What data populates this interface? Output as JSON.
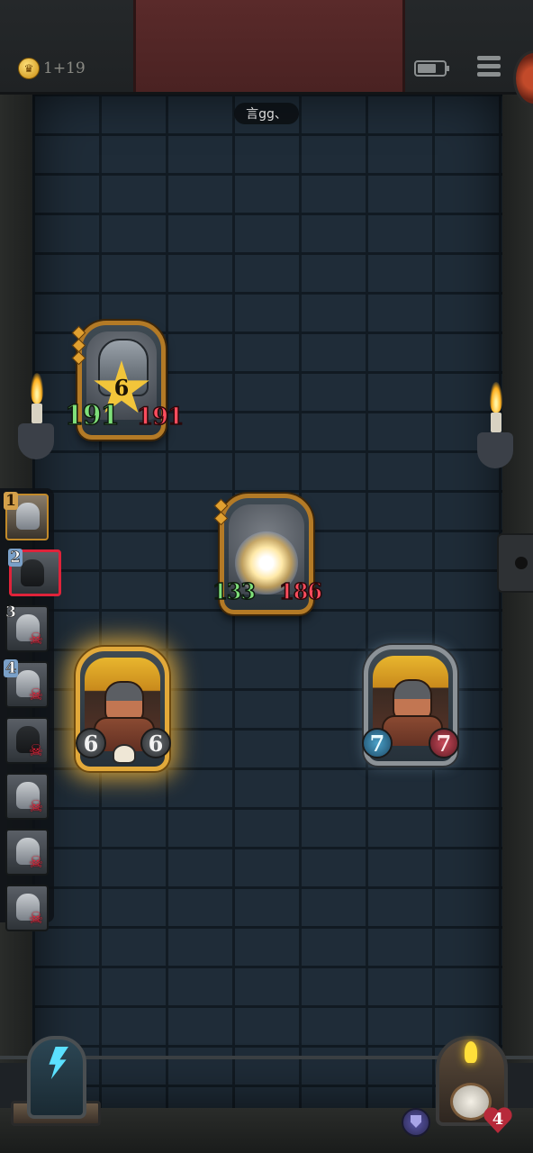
{
  "header": {
    "gold": "1+19",
    "player_name": "言gg、"
  },
  "icons": [
    "crown-coin-icon",
    "battery-icon",
    "menu-icon",
    "shield-icon",
    "heart-icon",
    "skull-icon",
    "lightning-lantern-icon",
    "clock-icon"
  ],
  "board": {
    "boss_card": {
      "level": "6",
      "attack": "191",
      "health": "191"
    },
    "orb_card": {
      "attack": "133",
      "health": "186"
    },
    "player_warrior": {
      "attack": "6",
      "health": "6"
    },
    "enemy_warrior": {
      "attack": "7",
      "health": "7"
    }
  },
  "turn_order": {
    "slots": [
      {
        "num": "1",
        "state": "ally"
      },
      {
        "num": "2",
        "state": "active"
      },
      {
        "num": "3",
        "state": "dead"
      },
      {
        "num": "4",
        "state": "dead"
      },
      {
        "num": "",
        "state": "dead"
      },
      {
        "num": "",
        "state": "dead"
      },
      {
        "num": "",
        "state": "dead"
      },
      {
        "num": "",
        "state": "dead"
      }
    ]
  },
  "bottom": {
    "lives": "4"
  },
  "colors": {
    "attack_green": "#7fe07a",
    "health_red": "#ff4d5e",
    "gold_frame": "#b37a26",
    "active_slot": "#e0233a"
  }
}
